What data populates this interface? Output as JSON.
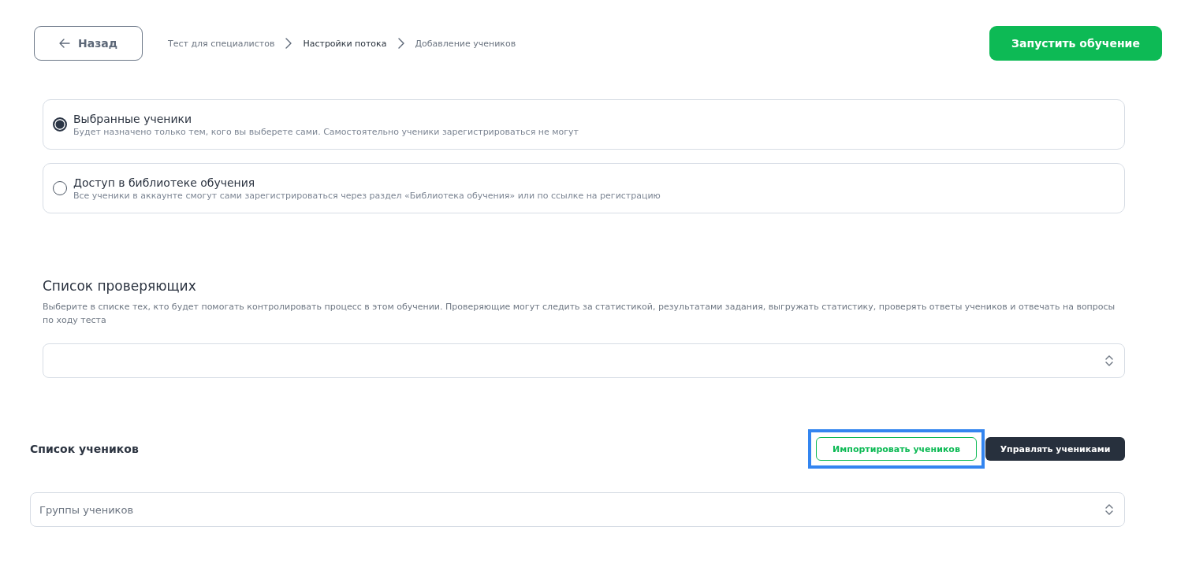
{
  "header": {
    "back_button": "Назад",
    "breadcrumbs": [
      {
        "label": "Тест для специалистов",
        "current": false
      },
      {
        "label": "Настройки потока",
        "current": true
      },
      {
        "label": "Добавление учеников",
        "current": false
      }
    ],
    "start_button": "Запустить обучение"
  },
  "access_options": [
    {
      "title": "Выбранные ученики",
      "description": "Будет назначено только тем, кого вы выберете сами. Самостоятельно ученики зарегистрироваться не могут",
      "selected": true
    },
    {
      "title": "Доступ в библиотеке обучения",
      "description": "Все ученики в аккаунте смогут сами зарегистрироваться через раздел «Библиотека обучения» или по ссылке на регистрацию",
      "selected": false
    }
  ],
  "reviewers": {
    "title": "Список проверяющих",
    "description": "Выберите в списке тех, кто будет помогать контролировать процесс в этом обучении. Проверяющие могут следить за статистикой, результатами задания, выгружать статистику, проверять ответы учеников и отвечать на вопросы по ходу теста"
  },
  "students": {
    "title": "Список учеников",
    "import_button": {
      "label": "Импортировать учеников",
      "highlighted": true
    },
    "manage_button": "Управлять учениками",
    "groups_select": {
      "placeholder": "Группы учеников"
    }
  }
}
